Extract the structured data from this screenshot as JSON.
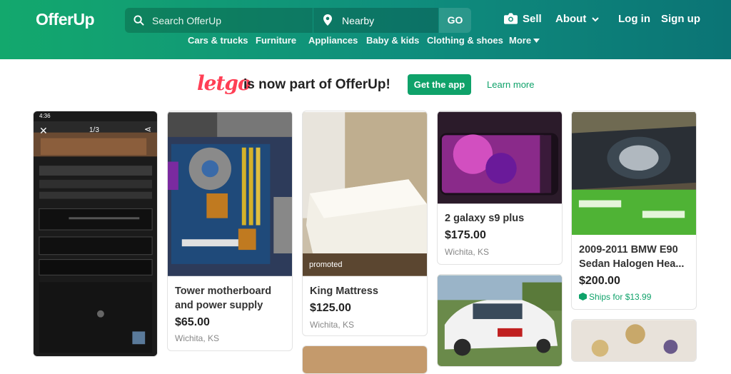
{
  "header": {
    "logo": "OfferUp",
    "search": {
      "placeholder": "Search OfferUp",
      "value": ""
    },
    "location": "Nearby",
    "go_label": "GO",
    "sell_label": "Sell",
    "about_label": "About",
    "login_label": "Log in",
    "signup_label": "Sign up"
  },
  "categories": [
    "Cars & trucks",
    "Furniture",
    "Appliances",
    "Baby & kids",
    "Clothing & shoes",
    "More"
  ],
  "banner": {
    "letgo": "letgo",
    "text": "is now part of OfferUp!",
    "get_app": "Get the app",
    "learn_more": "Learn more"
  },
  "listings": [
    {
      "title": "",
      "price": "",
      "location": "",
      "photo_overlay": {
        "time": "4:36",
        "counter": "1/3"
      }
    },
    {
      "title": "Tower motherboard and power supply",
      "price": "$65.00",
      "location": "Wichita, KS"
    },
    {
      "title": "King Mattress",
      "price": "$125.00",
      "location": "Wichita, KS",
      "badge": "promoted"
    },
    {
      "title": "2 galaxy s9 plus",
      "price": "$175.00",
      "location": "Wichita, KS"
    },
    {
      "title": "2009-2011 BMW E90 Sedan Halogen Hea...",
      "price": "$200.00",
      "shipping": "Ships for $13.99"
    }
  ],
  "colors": {
    "brand_green": "#0fa26a",
    "letgo_red": "#ff3f55"
  }
}
